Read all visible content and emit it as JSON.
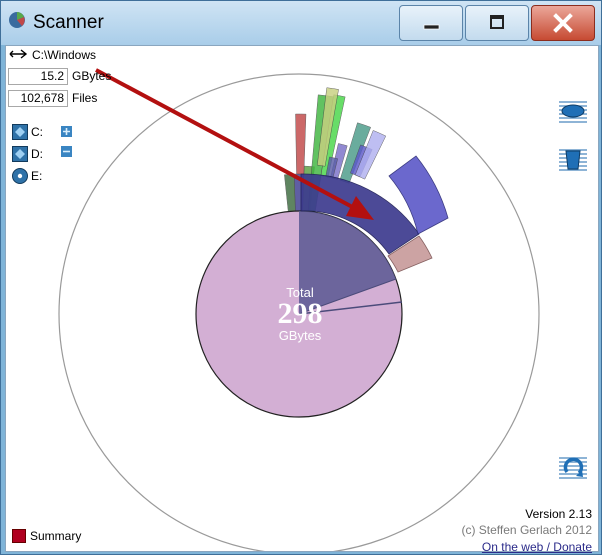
{
  "window": {
    "title": "Scanner"
  },
  "header": {
    "path": "C:\\Windows"
  },
  "stats": {
    "size_value": "15.2",
    "size_unit": "GBytes",
    "files_value": "102,678",
    "files_unit": "Files"
  },
  "drives": [
    {
      "label": "C:",
      "icon": "hard-drive-icon"
    },
    {
      "label": "D:",
      "icon": "hard-drive-icon"
    },
    {
      "label": "E:",
      "icon": "cd-drive-icon"
    }
  ],
  "center": {
    "caption": "Total",
    "value": "298",
    "unit": "GBytes"
  },
  "footer": {
    "version": "Version 2.13",
    "copyright": "(c) Steffen Gerlach 2012",
    "link": "On the web / Donate",
    "summary": "Summary"
  },
  "colors": {
    "title_gradient_top": "#cfe4f4",
    "close_button": "#c64a32",
    "disk_used": "#d3afd4",
    "windows_segment": "#3d3b8f",
    "summary_badge": "#b00020",
    "annotation_arrow": "#b31010"
  }
}
